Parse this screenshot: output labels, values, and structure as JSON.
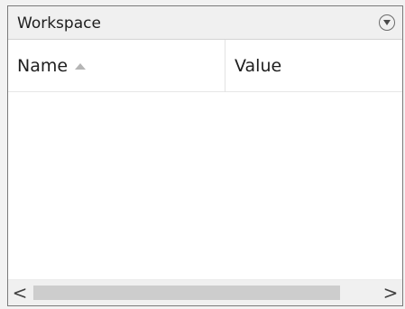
{
  "panel": {
    "title": "Workspace"
  },
  "table": {
    "columns": [
      {
        "label": "Name",
        "sorted": "ascending"
      },
      {
        "label": "Value"
      }
    ],
    "rows": []
  },
  "scrollbar": {
    "left_glyph": "<",
    "right_glyph": ">"
  },
  "icons": {
    "panel_menu": "chevron-down-circle-icon",
    "sort": "sort-ascending-icon"
  },
  "colors": {
    "border": "#7a7a7a",
    "titlebar_bg": "#f0f0f0",
    "scroll_thumb": "#cdcdcd"
  }
}
